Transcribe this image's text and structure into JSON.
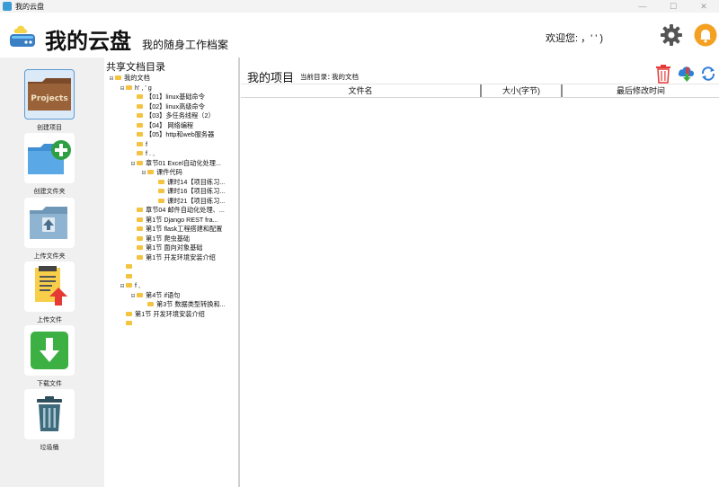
{
  "window": {
    "title": "我的云盘",
    "min": "—",
    "max": "☐",
    "close": "✕"
  },
  "header": {
    "title": "我的云盘",
    "subtitle": "我的随身工作档案",
    "welcome": "欢迎您: ，'    '      )"
  },
  "sidebar": {
    "items": [
      {
        "label": "创建项目",
        "icon": "projects-folder-icon",
        "badge": "Projects"
      },
      {
        "label": "创建文件夹",
        "icon": "add-folder-icon"
      },
      {
        "label": "上传文件夹",
        "icon": "upload-folder-icon"
      },
      {
        "label": "上传文件",
        "icon": "upload-file-icon"
      },
      {
        "label": "下载文件",
        "icon": "download-icon"
      },
      {
        "label": "垃圾桶",
        "icon": "trash-icon"
      }
    ]
  },
  "tree": {
    "title": "共享文档目录",
    "nodes": [
      {
        "text": "我的文档",
        "level": 0,
        "toggle": "⊟"
      },
      {
        "text": "h'  , '  g",
        "level": 1,
        "toggle": "⊟"
      },
      {
        "text": "【01】linux基础命令",
        "level": 2,
        "toggle": ""
      },
      {
        "text": "【02】linux高级命令",
        "level": 2,
        "toggle": ""
      },
      {
        "text": "【03】多任务线程（2）",
        "level": 2,
        "toggle": ""
      },
      {
        "text": "【04】 网络编程",
        "level": 2,
        "toggle": ""
      },
      {
        "text": "【05】http和web服务器",
        "level": 2,
        "toggle": ""
      },
      {
        "text": "f",
        "level": 2,
        "toggle": ""
      },
      {
        "text": "f  .  ,",
        "level": 2,
        "toggle": ""
      },
      {
        "text": "章节01 Excel自动化处理...",
        "level": 2,
        "toggle": "⊟"
      },
      {
        "text": "课件代码",
        "level": 3,
        "toggle": "⊟"
      },
      {
        "text": "课时14【项目练习...",
        "level": 4,
        "toggle": ""
      },
      {
        "text": "课时16【项目练习...",
        "level": 4,
        "toggle": ""
      },
      {
        "text": "课时21【项目练习...",
        "level": 4,
        "toggle": ""
      },
      {
        "text": "章节04 邮件自动化处理、...",
        "level": 2,
        "toggle": ""
      },
      {
        "text": "第1节 Django REST fra...",
        "level": 2,
        "toggle": ""
      },
      {
        "text": "第1节 flask工程搭建和配置",
        "level": 2,
        "toggle": ""
      },
      {
        "text": "第1节 爬虫基础",
        "level": 2,
        "toggle": ""
      },
      {
        "text": "第1节 面向对象基础",
        "level": 2,
        "toggle": ""
      },
      {
        "text": "第1节 开发环境安装介绍",
        "level": 2,
        "toggle": ""
      },
      {
        "text": "",
        "level": 1,
        "toggle": ""
      },
      {
        "text": "",
        "level": 1,
        "toggle": ""
      },
      {
        "text": "f  ,",
        "level": 1,
        "toggle": "⊟"
      },
      {
        "text": "第4节 if语句",
        "level": 2,
        "toggle": "⊟"
      },
      {
        "text": "第3节 数据类型转换和...",
        "level": 3,
        "toggle": ""
      },
      {
        "text": "第1节 开发环境安装介绍",
        "level": 1,
        "toggle": ""
      },
      {
        "text": "",
        "level": 1,
        "toggle": ""
      }
    ]
  },
  "main": {
    "title": "我的项目",
    "current_dir_label": "当前目录：",
    "current_dir": "我的文档",
    "columns": [
      "文件名",
      "大小(字节)",
      "最后修改时间"
    ],
    "tools": [
      "delete-icon",
      "cloud-download-icon",
      "refresh-icon"
    ]
  },
  "colors": {
    "accent": "#5b9bd5",
    "folder": "#f5c342",
    "green": "#3cb043",
    "orange": "#f4a020",
    "red": "#e53935"
  }
}
